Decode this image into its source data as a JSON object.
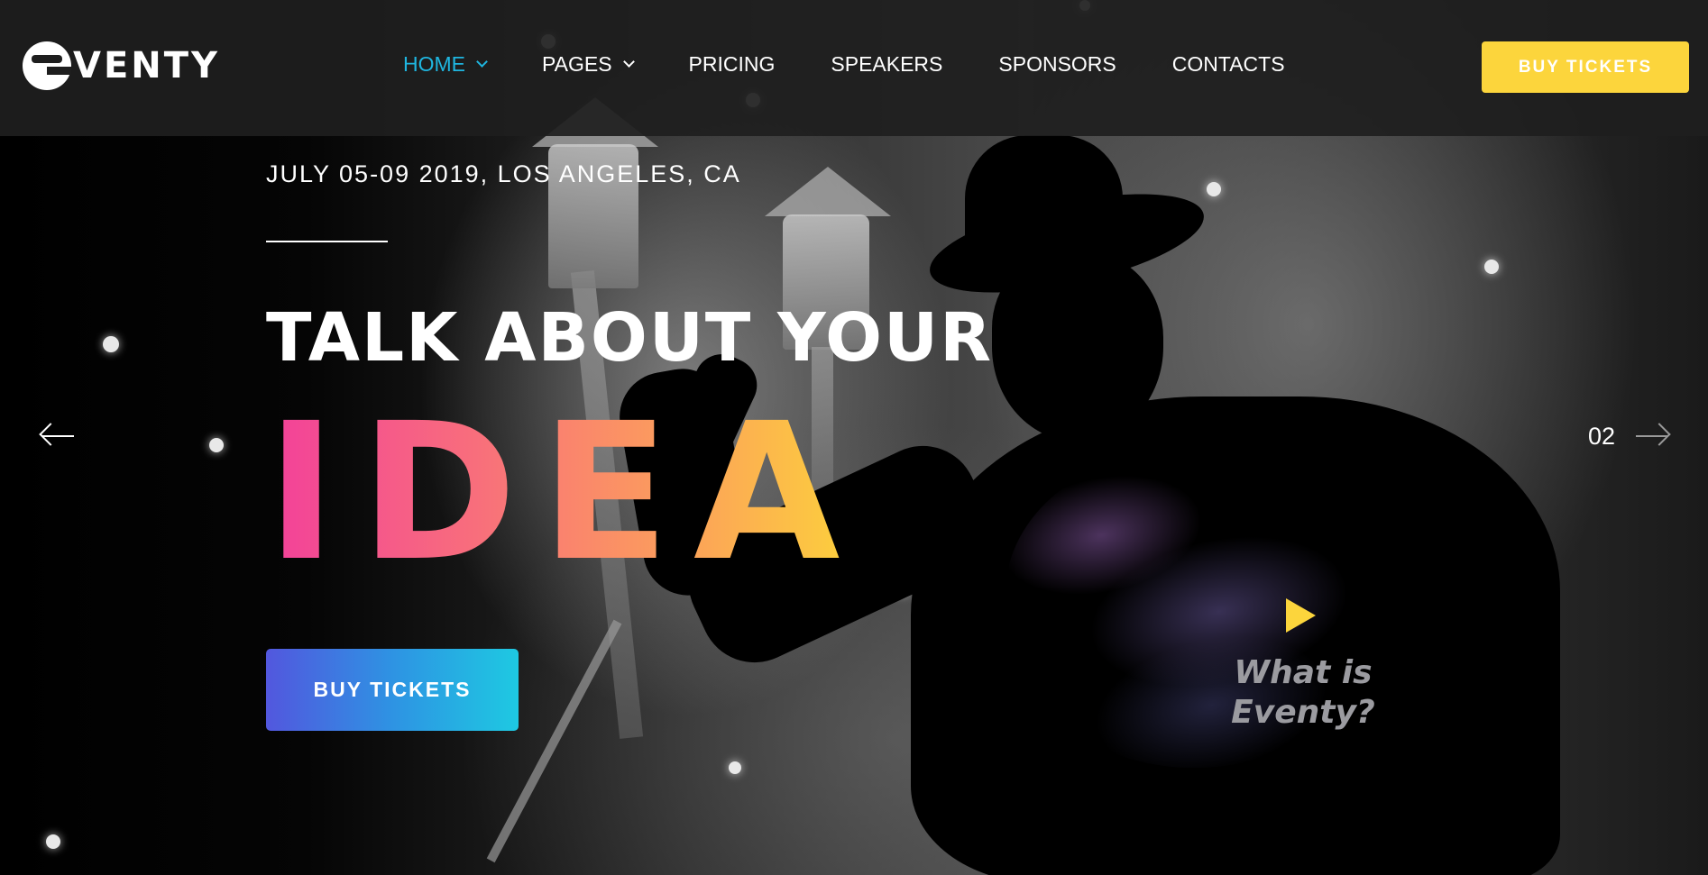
{
  "header": {
    "logo_text": "VENTY",
    "nav": [
      {
        "label": "HOME",
        "active": true,
        "dropdown": true
      },
      {
        "label": "PAGES",
        "active": false,
        "dropdown": true
      },
      {
        "label": "PRICING",
        "active": false,
        "dropdown": false
      },
      {
        "label": "SPEAKERS",
        "active": false,
        "dropdown": false
      },
      {
        "label": "SPONSORS",
        "active": false,
        "dropdown": false
      },
      {
        "label": "CONTACTS",
        "active": false,
        "dropdown": false
      }
    ],
    "buy_button_label": "BUY TICKETS"
  },
  "hero": {
    "date_location": "JULY 05-09 2019, LOS ANGELES, CA",
    "headline": "TALK ABOUT YOUR",
    "highlight": "IDEA",
    "buy_button_label": "BUY TICKETS",
    "slide_number": "02",
    "video_label_line1": "What is",
    "video_label_line2": "Eventy?"
  },
  "colors": {
    "accent_blue": "#1fb6e0",
    "accent_yellow": "#fcd53c",
    "gradient_pink": "#f2409a",
    "gradient_orange": "#fca15a",
    "button_gradient_start": "#5257de",
    "button_gradient_end": "#1ec9e2"
  },
  "icons": {
    "prev": "arrow-left-icon",
    "next": "arrow-right-icon",
    "play": "play-icon",
    "dropdown": "chevron-down-icon"
  }
}
